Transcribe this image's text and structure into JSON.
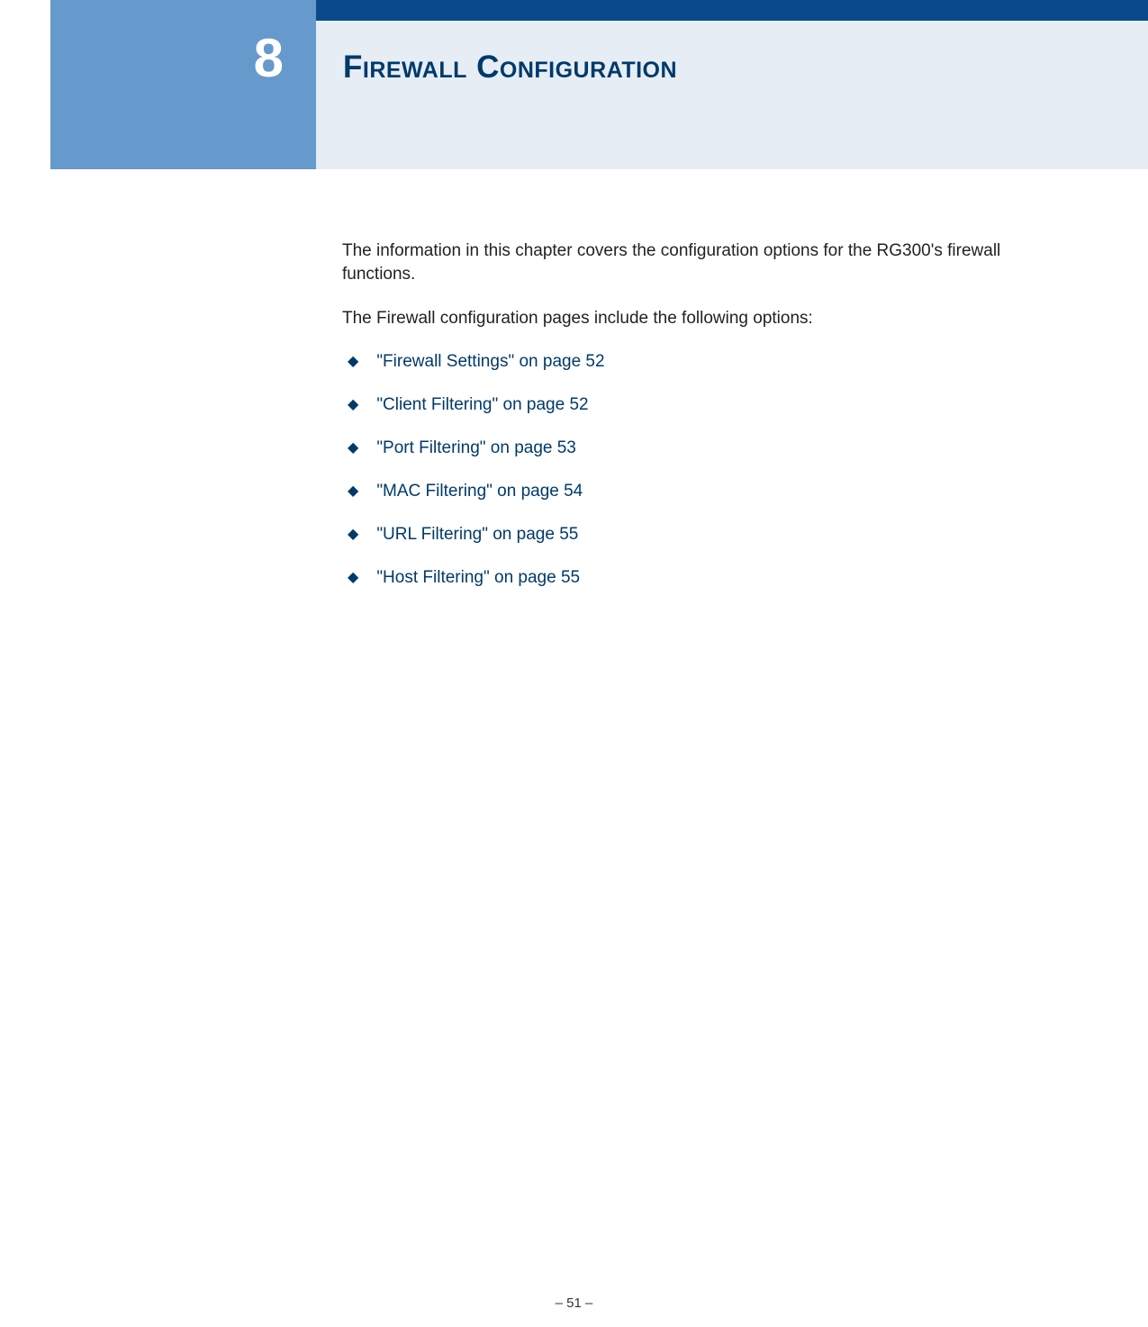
{
  "chapter": {
    "number": "8",
    "title": "Firewall Configuration"
  },
  "body": {
    "intro": "The information in this chapter covers the configuration options for the RG300's firewall functions.",
    "subintro": "The Firewall configuration pages include the following options:",
    "links": [
      "\"Firewall Settings\" on page 52",
      "\"Client Filtering\" on page 52",
      "\"Port Filtering\" on page 53",
      "\"MAC Filtering\" on page 54",
      "\"URL Filtering\" on page 55",
      "\"Host Filtering\" on page 55"
    ]
  },
  "footer": {
    "page": "–  51  –"
  }
}
